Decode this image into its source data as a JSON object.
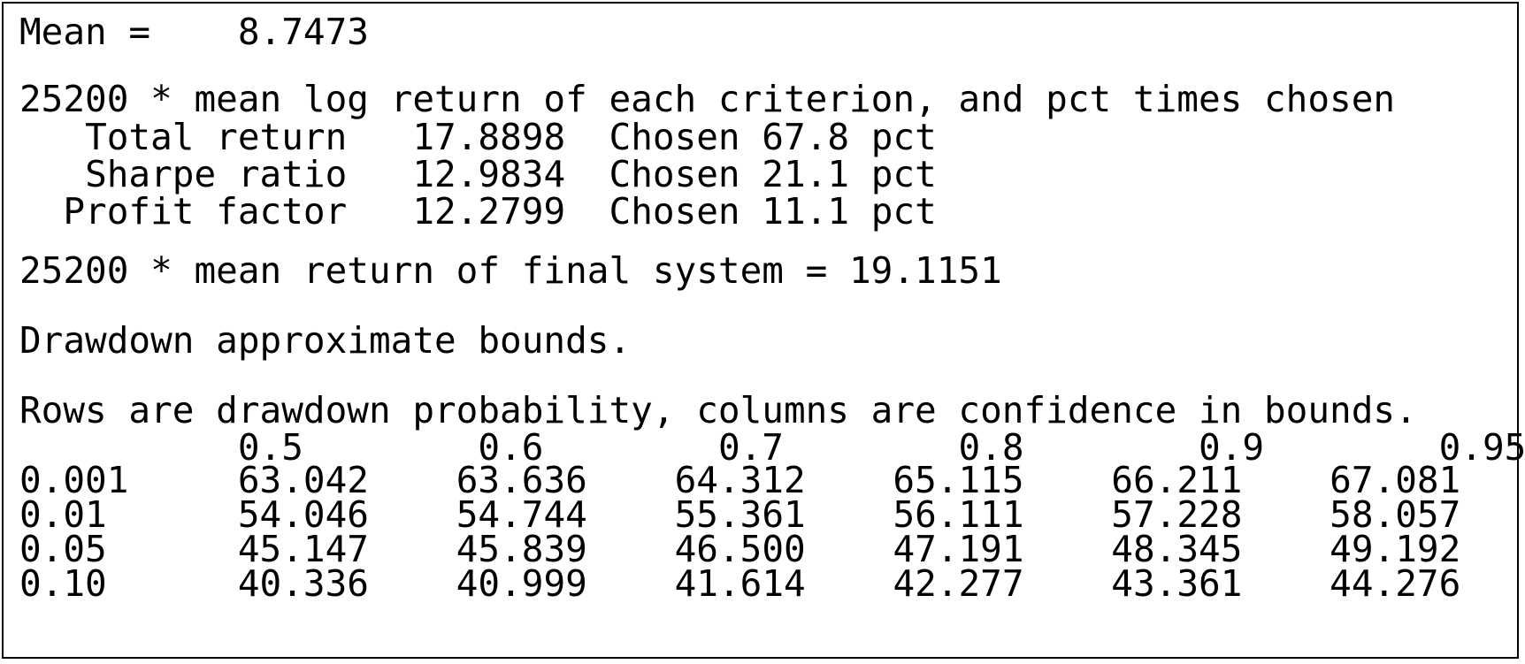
{
  "mean_line": {
    "label": "Mean =",
    "value": "8.7473"
  },
  "criteria_section": {
    "heading": "25200 * mean log return of each criterion, and pct times chosen",
    "rows": [
      {
        "name": "Total return",
        "value": "17.8898",
        "chosen": "Chosen 67.8 pct"
      },
      {
        "name": "Sharpe ratio",
        "value": "12.9834",
        "chosen": "Chosen 21.1 pct"
      },
      {
        "name": "Profit factor",
        "value": "12.2799",
        "chosen": "Chosen 11.1 pct"
      }
    ]
  },
  "final_system_line": "25200 * mean return of final system = 19.1151",
  "drawdown_heading": "Drawdown approximate bounds.",
  "bounds_table": {
    "caption": "Rows are drawdown probability, columns are confidence in bounds.",
    "columns": [
      "0.5",
      "0.6",
      "0.7",
      "0.8",
      "0.9",
      "0.95"
    ],
    "rows": [
      {
        "prob": "0.001",
        "values": [
          "63.042",
          "63.636",
          "64.312",
          "65.115",
          "66.211",
          "67.081"
        ]
      },
      {
        "prob": "0.01",
        "values": [
          "54.046",
          "54.744",
          "55.361",
          "56.111",
          "57.228",
          "58.057"
        ]
      },
      {
        "prob": "0.05",
        "values": [
          "45.147",
          "45.839",
          "46.500",
          "47.191",
          "48.345",
          "49.192"
        ]
      },
      {
        "prob": "0.10",
        "values": [
          "40.336",
          "40.999",
          "41.614",
          "42.277",
          "43.361",
          "44.276"
        ]
      }
    ]
  }
}
